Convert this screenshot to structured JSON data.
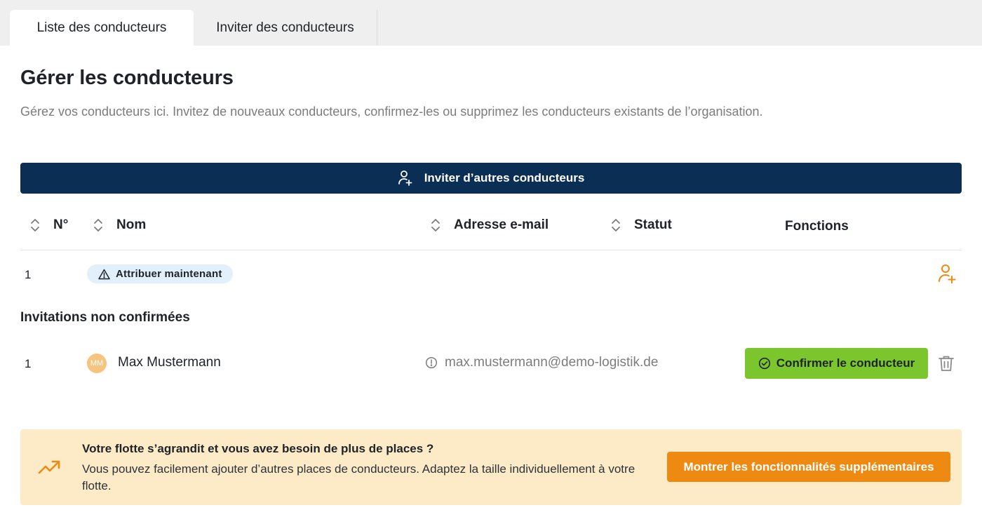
{
  "tabs": [
    {
      "label": "Liste des conducteurs",
      "active": true
    },
    {
      "label": "Inviter des conducteurs",
      "active": false
    }
  ],
  "header": {
    "title": "Gérer les conducteurs",
    "subtitle": "Gérez vos conducteurs ici. Invitez de nouveaux conducteurs, confirmez-les ou supprimez les conducteurs existants de l’organisation."
  },
  "invite_button": {
    "label": "Inviter d’autres conducteurs",
    "icon": "user-plus-icon"
  },
  "table": {
    "columns": {
      "number": "N°",
      "name": "Nom",
      "email": "Adresse e-mail",
      "status": "Statut",
      "functions": "Fonctions"
    },
    "rows": [
      {
        "number": "1",
        "badge": "Attribuer maintenant",
        "badge_icon": "warning-icon",
        "action_icon": "user-plus-icon"
      }
    ]
  },
  "unconfirmed": {
    "title": "Invitations non confirmées",
    "rows": [
      {
        "number": "1",
        "initials": "MM",
        "name": "Max Mustermann",
        "email": "max.mustermann@demo-logistik.de",
        "email_icon": "info-icon",
        "confirm_label": "Confirmer le conducteur",
        "delete_icon": "trash-icon"
      }
    ]
  },
  "banner": {
    "title": "Votre flotte s’agrandit et vous avez besoin de plus de places ?",
    "text": "Vous pouvez facilement ajouter d’autres places de conducteurs. Adaptez la taille individuellement à votre flotte.",
    "button_label": "Montrer les fonctionnalités supplémentaires",
    "icon": "trending-up-icon"
  },
  "colors": {
    "navy": "#0b2e55",
    "green": "#7bc62d",
    "orange": "#ee8a11",
    "banner_bg": "#fdebc8",
    "badge_bg": "#e1f0fb"
  }
}
